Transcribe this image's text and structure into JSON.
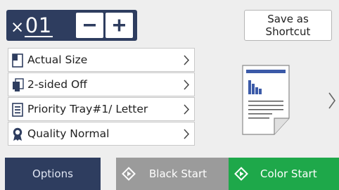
{
  "copies": {
    "prefix": "×",
    "value": "01"
  },
  "shortcut": {
    "line1": "Save as",
    "line2": "Shortcut"
  },
  "settings": [
    {
      "label": "Actual Size",
      "icon": "page-size-icon"
    },
    {
      "label": "2-sided Off",
      "icon": "duplex-icon"
    },
    {
      "label": "Priority Tray#1/ Letter",
      "icon": "tray-icon"
    },
    {
      "label": "Quality Normal",
      "icon": "quality-ribbon-icon"
    }
  ],
  "buttons": {
    "options": "Options",
    "black_start": "Black Start",
    "color_start": "Color Start"
  },
  "colors": {
    "navy": "#2e3d5f",
    "green": "#1ea84a",
    "gray": "#9b9b9b",
    "preview_blue": "#3b5aa8"
  }
}
